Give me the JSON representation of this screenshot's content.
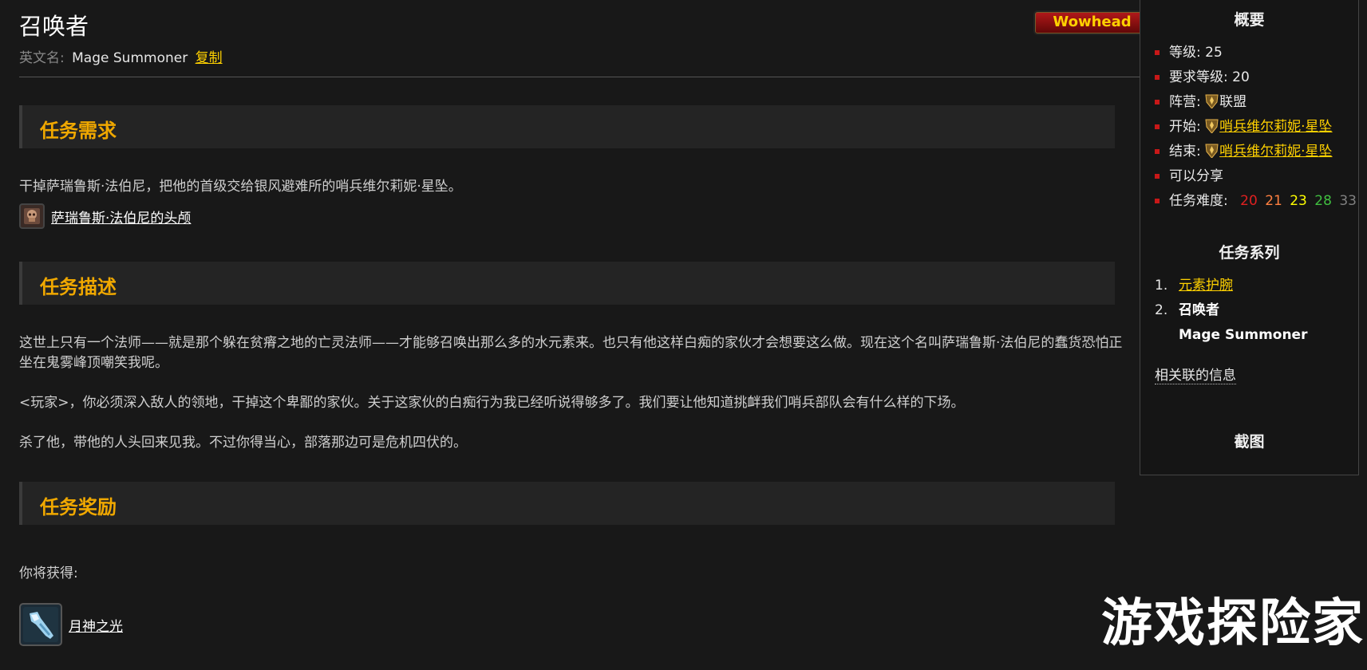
{
  "header": {
    "title": "召唤者",
    "english_name_label": "英文名:",
    "english_name": "Mage Summoner",
    "copy_label": "复制",
    "wowhead_button": "Wowhead"
  },
  "sections": {
    "requirements": {
      "heading": "任务需求",
      "text": "干掉萨瑞鲁斯·法伯尼，把他的首级交给银风避难所的哨兵维尔莉妮·星坠。",
      "item": "萨瑞鲁斯·法伯尼的头颅"
    },
    "description": {
      "heading": "任务描述",
      "paragraphs": [
        "这世上只有一个法师——就是那个躲在贫瘠之地的亡灵法师——才能够召唤出那么多的水元素来。也只有他这样白痴的家伙才会想要这么做。现在这个名叫萨瑞鲁斯·法伯尼的蠢货恐怕正坐在鬼雾峰顶嘲笑我呢。",
        "<玩家>，你必须深入敌人的领地，干掉这个卑鄙的家伙。关于这家伙的白痴行为我已经听说得够多了。我们要让他知道挑衅我们哨兵部队会有什么样的下场。",
        "杀了他，带他的人头回来见我。不过你得当心，部落那边可是危机四伏的。"
      ]
    },
    "rewards": {
      "heading": "任务奖励",
      "intro": "你将获得:",
      "item": "月神之光"
    }
  },
  "sidebar": {
    "summary_heading": "概要",
    "level": "等级: 25",
    "req_level": "要求等级: 20",
    "faction_label": "阵营:",
    "faction": "联盟",
    "start_label": "开始:",
    "start_npc": "哨兵维尔莉妮·星坠",
    "end_label": "结束:",
    "end_npc": "哨兵维尔莉妮·星坠",
    "shareable": "可以分享",
    "difficulty_label": "任务难度:",
    "difficulty": [
      {
        "value": "20",
        "color": "#e02020"
      },
      {
        "value": "21",
        "color": "#ff8040"
      },
      {
        "value": "23",
        "color": "#ffff00"
      },
      {
        "value": "28",
        "color": "#40bf40"
      },
      {
        "value": "33",
        "color": "#808080"
      }
    ],
    "series_heading": "任务系列",
    "series": [
      {
        "num": "1.",
        "name": "元素护腕"
      },
      {
        "num": "2.",
        "name": "召唤者",
        "name_en": "Mage Summoner"
      }
    ],
    "related_info": "相关联的信息",
    "screenshot_heading": "截图"
  },
  "watermark": "游戏探险家"
}
